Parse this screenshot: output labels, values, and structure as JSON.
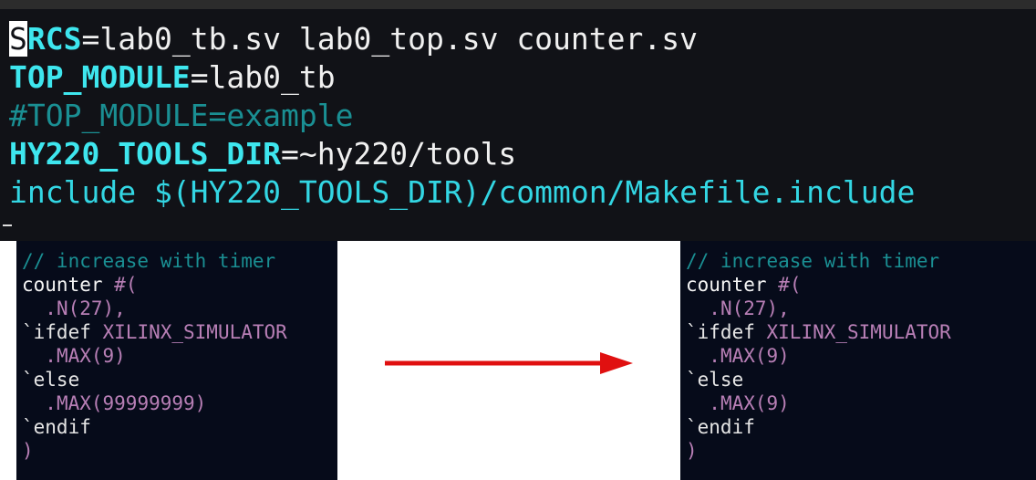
{
  "top_editor": {
    "lines": [
      {
        "cursor": "S",
        "key": "RCS",
        "eq": "=",
        "value": "lab0_tb.sv lab0_top.sv counter.sv"
      },
      {
        "key": "TOP_MODULE",
        "eq": "=",
        "value": "lab0_tb"
      },
      {
        "comment": "#TOP_MODULE=example"
      },
      {
        "key": "HY220_TOOLS_DIR",
        "eq": "=",
        "value": "~hy220/tools"
      },
      {
        "plain": "include $(HY220_TOOLS_DIR)/common/Makefile.include"
      }
    ]
  },
  "left_code": {
    "comment": "// increase with timer",
    "module": "counter",
    "hash_paren": "#(",
    "n_param": ".N(27),",
    "ifdef": "`ifdef",
    "ifdef_sym": "XILINX_SIMULATOR",
    "max_a": ".MAX(9)",
    "else": "`else",
    "max_b": ".MAX(99999999)",
    "endif": "`endif",
    "close": ")"
  },
  "right_code": {
    "comment": "// increase with timer",
    "module": "counter",
    "hash_paren": "#(",
    "n_param": ".N(27),",
    "ifdef": "`ifdef",
    "ifdef_sym": "XILINX_SIMULATOR",
    "max_a": ".MAX(9)",
    "else": "`else",
    "max_b": ".MAX(9)",
    "endif": "`endif",
    "close": ")"
  },
  "colors": {
    "arrow": "#e01010",
    "keyword": "#3ee6ee",
    "comment": "#1a8f93",
    "param": "#b87fb6"
  },
  "icons": {
    "arrow": "right-arrow-icon"
  }
}
